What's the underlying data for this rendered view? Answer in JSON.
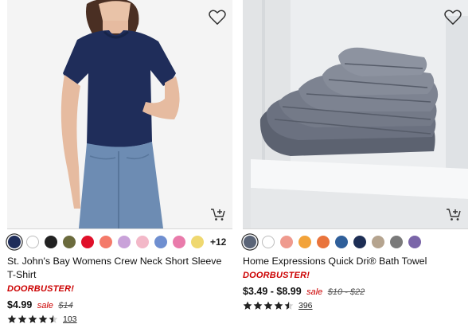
{
  "products": [
    {
      "title": "St. John's Bay Womens Crew Neck Short Sleeve T-Shirt",
      "badge": "DOORBUSTER!",
      "price": "$4.99",
      "sale_label": "sale",
      "original_price": "$14",
      "rating": 4.5,
      "review_count": "103",
      "more_colors": "+12",
      "swatches": [
        "#1f2d5a",
        "#ffffff",
        "#222222",
        "#6b6b3d",
        "#e0102a",
        "#f47a6a",
        "#c9a2d9",
        "#f3b8c8",
        "#6f8fd0",
        "#e97bab",
        "#efd870"
      ]
    },
    {
      "title": "Home Expressions Quick Dri® Bath Towel",
      "badge": "DOORBUSTER!",
      "price": "$3.49 - $8.99",
      "sale_label": "sale",
      "original_price": "$10 - $22",
      "rating": 4.5,
      "review_count": "396",
      "swatches": [
        "#5a6477",
        "#ffffff",
        "#ef9a8e",
        "#f2a33a",
        "#e9743c",
        "#2f5f9a",
        "#1d2e55",
        "#b5a48f",
        "#7a7a7a",
        "#7a65a8"
      ]
    }
  ],
  "icons": {
    "heart": "heart-outline-icon",
    "cart": "add-to-cart-icon",
    "star": "star-icon"
  },
  "colors": {
    "accent_red": "#cc0000",
    "star": "#222222"
  }
}
